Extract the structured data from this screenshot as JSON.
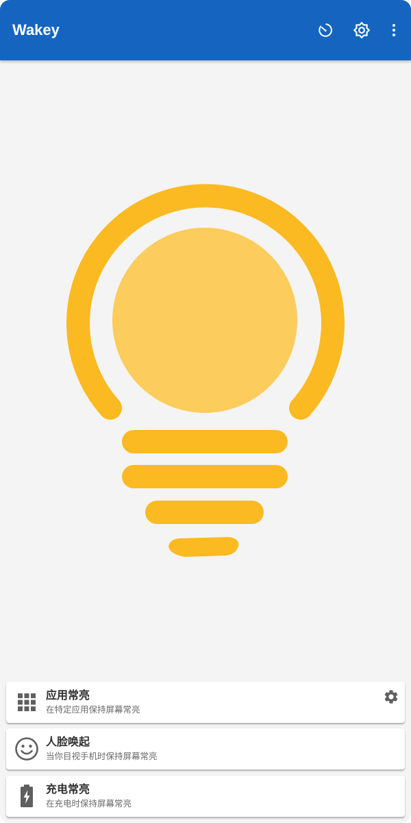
{
  "app": {
    "title": "Wakey",
    "accent_color": "#1565c0",
    "bulb_color": "#fbba22",
    "bulb_fill_color": "#fccc5c"
  },
  "toolbar": {
    "icons": [
      "timer-icon",
      "brightness-settings-icon",
      "more-vert-icon"
    ]
  },
  "cards": [
    {
      "title": "应用常亮",
      "subtitle": "在特定应用保持屏幕常亮",
      "icon": "apps-grid-icon",
      "action_icon": "settings-gear-icon"
    },
    {
      "title": "人脸唤起",
      "subtitle": "当你目视手机时保持屏幕常亮",
      "icon": "face-icon"
    },
    {
      "title": "充电常亮",
      "subtitle": "在充电时保持屏幕常亮",
      "icon": "battery-charging-icon"
    }
  ]
}
